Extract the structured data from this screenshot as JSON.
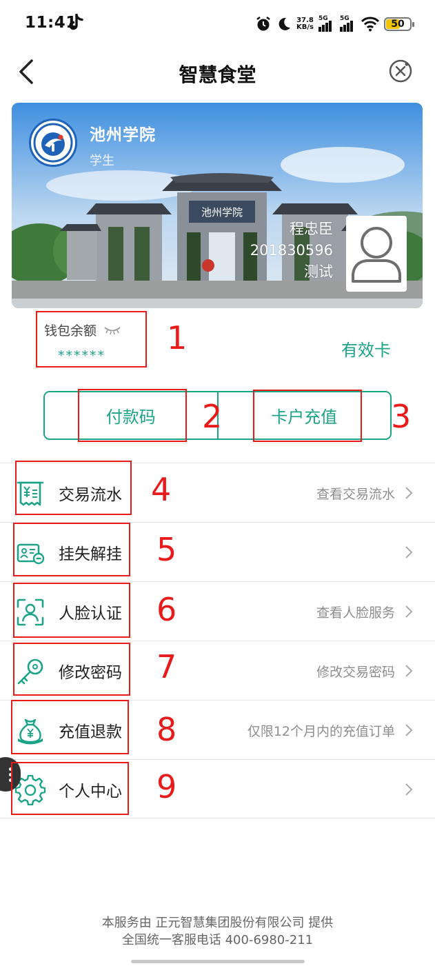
{
  "status_bar": {
    "time": "11:41",
    "net_speed_value": "37.8",
    "net_speed_unit": "KB/s",
    "signal1": "5G",
    "signal2": "5G",
    "battery": "50"
  },
  "header": {
    "title": "智慧食堂"
  },
  "card": {
    "school": "池州学院",
    "role": "学生",
    "gate_sign": "池州学院",
    "name": "程忠臣",
    "id": "201830596",
    "note": "测试"
  },
  "wallet": {
    "label": "钱包余额",
    "value": "******",
    "status": "有效卡"
  },
  "actions": {
    "pay_code": "付款码",
    "recharge": "卡户充值"
  },
  "menu": [
    {
      "label": "交易流水",
      "hint": "查看交易流水",
      "icon": "receipt-icon"
    },
    {
      "label": "挂失解挂",
      "hint": "",
      "icon": "id-card-icon"
    },
    {
      "label": "人脸认证",
      "hint": "查看人脸服务",
      "icon": "face-scan-icon"
    },
    {
      "label": "修改密码",
      "hint": "修改交易密码",
      "icon": "key-icon"
    },
    {
      "label": "充值退款",
      "hint": "仅限12个月内的充值订单",
      "icon": "money-bag-icon"
    },
    {
      "label": "个人中心",
      "hint": "",
      "icon": "gear-icon"
    }
  ],
  "annotations": [
    "1",
    "2",
    "3",
    "4",
    "5",
    "6",
    "7",
    "8",
    "9"
  ],
  "footer": {
    "line1": "本服务由 正元智慧集团股份有限公司 提供",
    "line2": "全国统一客服电话 400-6980-211"
  },
  "colors": {
    "accent": "#1aa386",
    "annotation": "#e81a1a"
  }
}
